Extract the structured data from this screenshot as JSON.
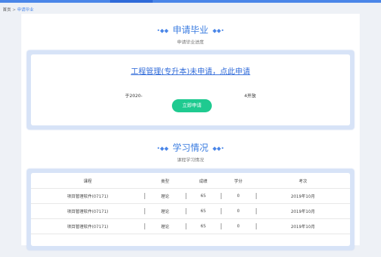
{
  "breadcrumb": {
    "parent": "首页",
    "separator": ">",
    "current": "申请毕业"
  },
  "sections": {
    "apply": {
      "title": "申请毕业",
      "subtitle": "申请毕业进度"
    },
    "study": {
      "title": "学习情况",
      "subtitle": "课程学习情况"
    }
  },
  "apply_panel": {
    "status_link": "工程管理(专升本)未申请，点此申请",
    "open_note_prefix": "于2020-",
    "open_note_suffix": "4开放",
    "apply_button": "立即申请"
  },
  "course_table": {
    "headers": [
      "课程",
      "类型",
      "成绩",
      "学分",
      "考次"
    ],
    "rows": [
      [
        "项目管理软件(07171)",
        "理论",
        "65",
        "0",
        "2019年10月"
      ],
      [
        "项目管理软件(07171)",
        "理论",
        "65",
        "0",
        "2019年10月"
      ],
      [
        "项目管理软件(07171)",
        "理论",
        "65",
        "0",
        "2019年10月"
      ]
    ]
  },
  "colors": {
    "accent": "#4a86e8",
    "button": "#1fca90",
    "frame": "#d7e3f7"
  }
}
